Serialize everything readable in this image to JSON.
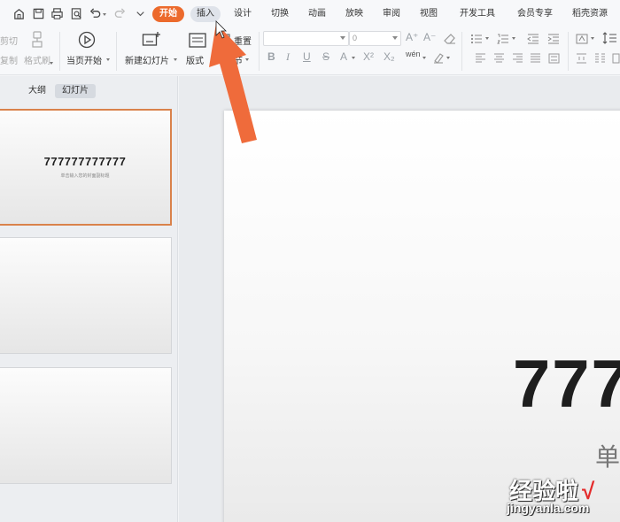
{
  "tabs": {
    "home": "开始",
    "insert": "插入",
    "design": "设计",
    "transition": "切换",
    "animation": "动画",
    "slideshow": "放映",
    "review": "审阅",
    "view": "视图",
    "developer": "开发工具",
    "member": "会员专享",
    "templates": "稻壳资源"
  },
  "ribbon": {
    "cut": "剪切",
    "copy": "复制",
    "format_painter": "格式刷",
    "play_from_current": "当页开始",
    "new_slide": "新建幻灯片",
    "layout": "版式",
    "reset": "重置",
    "section": "节",
    "font_size": "0",
    "pinyin": "wén"
  },
  "left_pane": {
    "tab_outline": "大纲",
    "tab_slides": "幻灯片",
    "thumb_title": "777777777777",
    "thumb_subtitle": "单击输入您的封面副标题"
  },
  "slide": {
    "title_visible": "777",
    "subtitle_visible": "单"
  },
  "watermark": {
    "brand": "经验啦",
    "check": "√",
    "url": "jingyanla.com"
  },
  "colors": {
    "accent": "#ec6a2c",
    "arrow": "#ef6b3b"
  }
}
